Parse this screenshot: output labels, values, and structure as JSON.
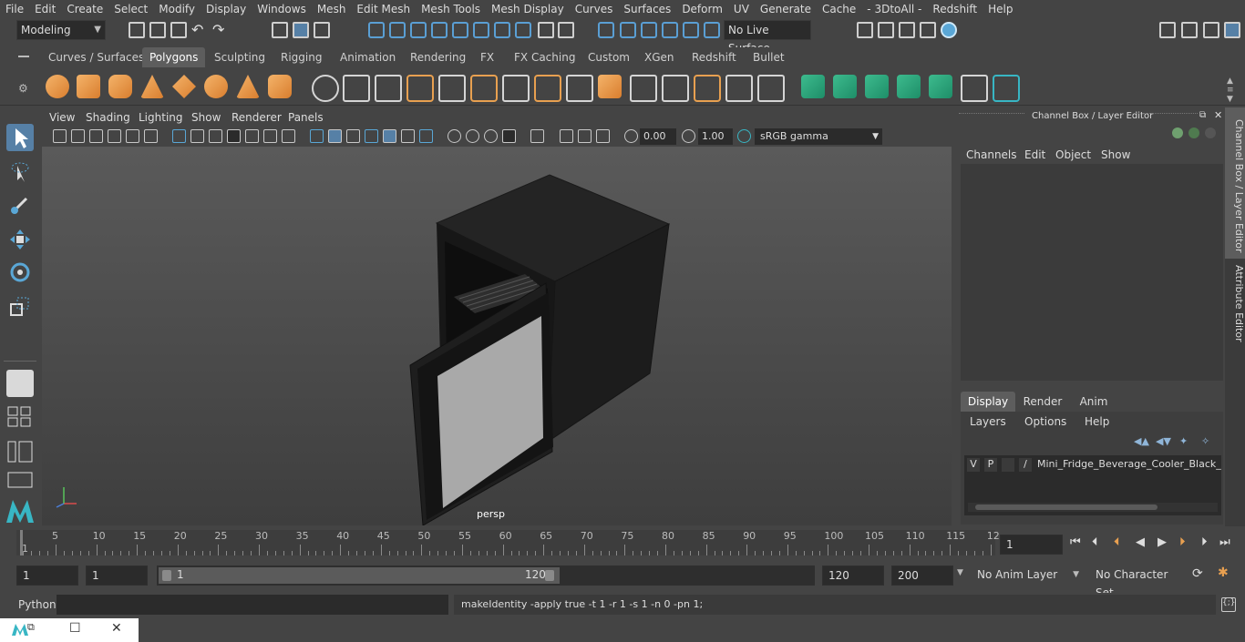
{
  "menubar": [
    "File",
    "Edit",
    "Create",
    "Select",
    "Modify",
    "Display",
    "Windows",
    "Mesh",
    "Edit Mesh",
    "Mesh Tools",
    "Mesh Display",
    "Curves",
    "Surfaces",
    "Deform",
    "UV",
    "Generate",
    "Cache",
    "- 3DtoAll -",
    "Redshift",
    "Help"
  ],
  "status": {
    "mode": "Modeling",
    "live_surface": "No Live Surface"
  },
  "shelf_tabs": [
    "Curves / Surfaces",
    "Polygons",
    "Sculpting",
    "Rigging",
    "Animation",
    "Rendering",
    "FX",
    "FX Caching",
    "Custom",
    "XGen",
    "Redshift",
    "Bullet"
  ],
  "shelf_active": "Polygons",
  "viewport": {
    "menu": [
      "View",
      "Shading",
      "Lighting",
      "Show",
      "Renderer",
      "Panels"
    ],
    "exposure": "0.00",
    "gamma": "1.00",
    "colorspace": "sRGB gamma",
    "camera": "persp"
  },
  "channel_box": {
    "title": "Channel Box / Layer Editor",
    "menu": [
      "Channels",
      "Edit",
      "Object",
      "Show"
    ],
    "layer_tabs": [
      "Display",
      "Render",
      "Anim"
    ],
    "layer_tab_active": "Display",
    "layer_menu": [
      "Layers",
      "Options",
      "Help"
    ],
    "layer": {
      "v": "V",
      "p": "P",
      "name": "Mini_Fridge_Beverage_Cooler_Black_Op"
    }
  },
  "side_tabs": [
    "Channel Box / Layer Editor",
    "Attribute Editor"
  ],
  "timeline": {
    "ticks": [
      "5",
      "10",
      "15",
      "20",
      "25",
      "30",
      "35",
      "40",
      "45",
      "50",
      "55",
      "60",
      "65",
      "70",
      "75",
      "80",
      "85",
      "90",
      "95",
      "100",
      "105",
      "110",
      "115",
      "12"
    ],
    "start_label": "1",
    "current_frame": "1"
  },
  "range": {
    "start": "1",
    "playback_start": "1",
    "slider_start": "1",
    "slider_end": "120",
    "playback_end": "120",
    "end": "200",
    "anim_layer": "No Anim Layer",
    "character_set": "No Character Set"
  },
  "command": {
    "lang": "Python",
    "output": "makeIdentity -apply true -t 1 -r 1 -s 1 -n 0 -pn 1;"
  },
  "colors": {
    "accent": "#5680a6",
    "shelf_orange": "#e8a050",
    "shelf_green": "#2aa57a",
    "maya_teal": "#38b6c4"
  }
}
